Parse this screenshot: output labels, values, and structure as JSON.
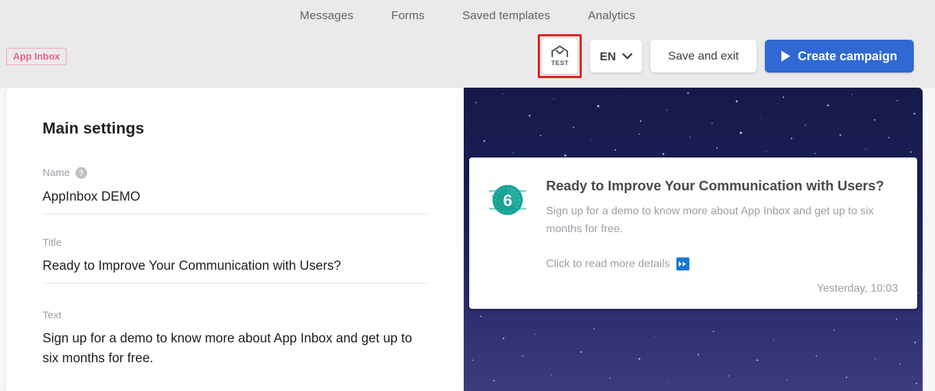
{
  "header": {
    "nav_tabs": [
      {
        "label": "Messages"
      },
      {
        "label": "Forms"
      },
      {
        "label": "Saved templates"
      },
      {
        "label": "Analytics"
      }
    ],
    "badge": {
      "label": "App Inbox",
      "color": "#ef5f8c",
      "border_color": "#f3a3bd"
    },
    "actions": {
      "test_label": "TEST",
      "test_icon": "open-inbox-icon",
      "test_highlight_color": "#e8140f",
      "language_code": "EN",
      "language_caret_icon": "chevron-down-icon",
      "save_label": "Save and exit",
      "create_label": "Create campaign",
      "create_icon": "play-icon",
      "create_color": "#3069d3"
    },
    "background_color": "#eaeaea"
  },
  "settings": {
    "title": "Main settings",
    "fields": [
      {
        "label": "Name",
        "help_icon": "question-mark-icon",
        "value": "AppInbox DEMO"
      },
      {
        "label": "Title",
        "value": "Ready to Improve Your Communication with Users?"
      },
      {
        "label": "Text",
        "value": "Sign up for a demo to know more about App Inbox and get up to six months for free."
      }
    ]
  },
  "preview": {
    "background_color": "#161a49",
    "background_description": "starfield",
    "card": {
      "avatar_icon": "clock-six-icon",
      "avatar_badge_number": "6",
      "avatar_color": "#1ca69b",
      "title": "Ready to Improve Your Communication with Users?",
      "text": "Sign up for a demo to know more about App Inbox and get up to six months for free.",
      "cta_label": "Click to read more details",
      "cta_icon": "fast-forward-icon",
      "cta_icon_glyph": "⏩",
      "cta_icon_color": "#1b78d4",
      "timestamp": "Yesterday, 10:03"
    }
  }
}
